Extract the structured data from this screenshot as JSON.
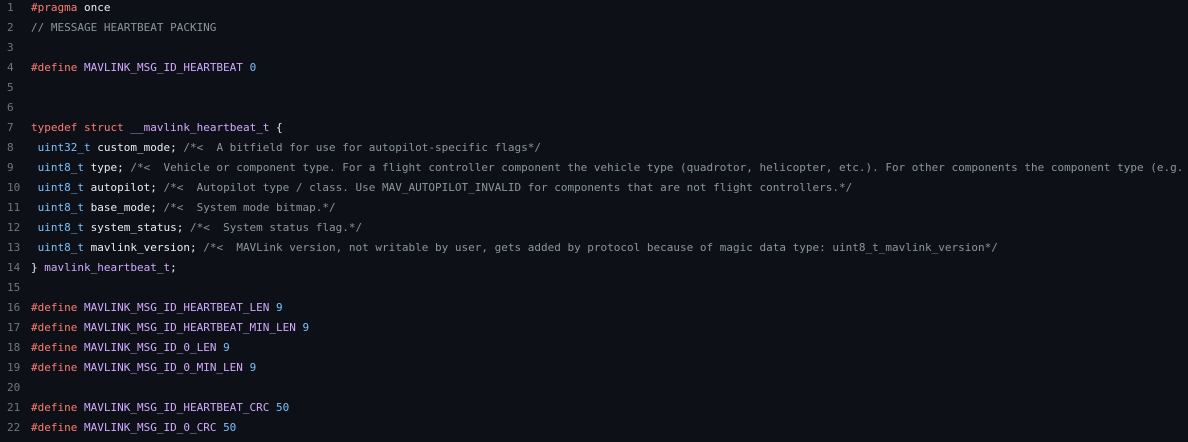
{
  "editor": {
    "lines": [
      {
        "n": "1",
        "tokens": [
          {
            "t": "#",
            "c": "kw"
          },
          {
            "t": "pragma",
            "c": "kw"
          },
          {
            "t": " once",
            "c": "plain"
          }
        ]
      },
      {
        "n": "2",
        "tokens": [
          {
            "t": "// MESSAGE HEARTBEAT PACKING",
            "c": "comment"
          }
        ]
      },
      {
        "n": "3",
        "tokens": []
      },
      {
        "n": "4",
        "tokens": [
          {
            "t": "#define",
            "c": "kw"
          },
          {
            "t": " ",
            "c": "plain"
          },
          {
            "t": "MAVLINK_MSG_ID_HEARTBEAT",
            "c": "def"
          },
          {
            "t": " ",
            "c": "plain"
          },
          {
            "t": "0",
            "c": "num"
          }
        ]
      },
      {
        "n": "5",
        "tokens": []
      },
      {
        "n": "6",
        "tokens": []
      },
      {
        "n": "7",
        "tokens": [
          {
            "t": "typedef",
            "c": "kw"
          },
          {
            "t": " ",
            "c": "plain"
          },
          {
            "t": "struct",
            "c": "kw"
          },
          {
            "t": " ",
            "c": "plain"
          },
          {
            "t": "__mavlink_heartbeat_t",
            "c": "def"
          },
          {
            "t": " {",
            "c": "punct"
          }
        ]
      },
      {
        "n": "8",
        "tokens": [
          {
            "t": " ",
            "c": "plain"
          },
          {
            "t": "uint32_t",
            "c": "type"
          },
          {
            "t": " custom_mode; ",
            "c": "ident"
          },
          {
            "t": "/*<  A bitfield for use for autopilot-specific flags*/",
            "c": "comment"
          }
        ]
      },
      {
        "n": "9",
        "tokens": [
          {
            "t": " ",
            "c": "plain"
          },
          {
            "t": "uint8_t",
            "c": "type"
          },
          {
            "t": " type; ",
            "c": "ident"
          },
          {
            "t": "/*<  Vehicle or component type. For a flight controller component the vehicle type (quadrotor, helicopter, etc.). For other components the component type (e.g.",
            "c": "comment"
          }
        ]
      },
      {
        "n": "10",
        "tokens": [
          {
            "t": " ",
            "c": "plain"
          },
          {
            "t": "uint8_t",
            "c": "type"
          },
          {
            "t": " autopilot; ",
            "c": "ident"
          },
          {
            "t": "/*<  Autopilot type / class. Use MAV_AUTOPILOT_INVALID for components that are not flight controllers.*/",
            "c": "comment"
          }
        ]
      },
      {
        "n": "11",
        "tokens": [
          {
            "t": " ",
            "c": "plain"
          },
          {
            "t": "uint8_t",
            "c": "type"
          },
          {
            "t": " base_mode; ",
            "c": "ident"
          },
          {
            "t": "/*<  System mode bitmap.*/",
            "c": "comment"
          }
        ]
      },
      {
        "n": "12",
        "tokens": [
          {
            "t": " ",
            "c": "plain"
          },
          {
            "t": "uint8_t",
            "c": "type"
          },
          {
            "t": " system_status; ",
            "c": "ident"
          },
          {
            "t": "/*<  System status flag.*/",
            "c": "comment"
          }
        ]
      },
      {
        "n": "13",
        "tokens": [
          {
            "t": " ",
            "c": "plain"
          },
          {
            "t": "uint8_t",
            "c": "type"
          },
          {
            "t": " mavlink_version; ",
            "c": "ident"
          },
          {
            "t": "/*<  MAVLink version, not writable by user, gets added by protocol because of magic data type: uint8_t_mavlink_version*/",
            "c": "comment"
          }
        ]
      },
      {
        "n": "14",
        "tokens": [
          {
            "t": "} ",
            "c": "punct"
          },
          {
            "t": "mavlink_heartbeat_t",
            "c": "def"
          },
          {
            "t": ";",
            "c": "punct"
          }
        ]
      },
      {
        "n": "15",
        "tokens": []
      },
      {
        "n": "16",
        "tokens": [
          {
            "t": "#define",
            "c": "kw"
          },
          {
            "t": " ",
            "c": "plain"
          },
          {
            "t": "MAVLINK_MSG_ID_HEARTBEAT_LEN",
            "c": "def"
          },
          {
            "t": " ",
            "c": "plain"
          },
          {
            "t": "9",
            "c": "num"
          }
        ]
      },
      {
        "n": "17",
        "tokens": [
          {
            "t": "#define",
            "c": "kw"
          },
          {
            "t": " ",
            "c": "plain"
          },
          {
            "t": "MAVLINK_MSG_ID_HEARTBEAT_MIN_LEN",
            "c": "def"
          },
          {
            "t": " ",
            "c": "plain"
          },
          {
            "t": "9",
            "c": "num"
          }
        ]
      },
      {
        "n": "18",
        "tokens": [
          {
            "t": "#define",
            "c": "kw"
          },
          {
            "t": " ",
            "c": "plain"
          },
          {
            "t": "MAVLINK_MSG_ID_0_LEN",
            "c": "def"
          },
          {
            "t": " ",
            "c": "plain"
          },
          {
            "t": "9",
            "c": "num"
          }
        ]
      },
      {
        "n": "19",
        "tokens": [
          {
            "t": "#define",
            "c": "kw"
          },
          {
            "t": " ",
            "c": "plain"
          },
          {
            "t": "MAVLINK_MSG_ID_0_MIN_LEN",
            "c": "def"
          },
          {
            "t": " ",
            "c": "plain"
          },
          {
            "t": "9",
            "c": "num"
          }
        ]
      },
      {
        "n": "20",
        "tokens": []
      },
      {
        "n": "21",
        "tokens": [
          {
            "t": "#define",
            "c": "kw"
          },
          {
            "t": " ",
            "c": "plain"
          },
          {
            "t": "MAVLINK_MSG_ID_HEARTBEAT_CRC",
            "c": "def"
          },
          {
            "t": " ",
            "c": "plain"
          },
          {
            "t": "50",
            "c": "num"
          }
        ]
      },
      {
        "n": "22",
        "tokens": [
          {
            "t": "#define",
            "c": "kw"
          },
          {
            "t": " ",
            "c": "plain"
          },
          {
            "t": "MAVLINK_MSG_ID_0_CRC",
            "c": "def"
          },
          {
            "t": " ",
            "c": "plain"
          },
          {
            "t": "50",
            "c": "num"
          }
        ]
      }
    ]
  },
  "colors": {
    "background": "#0d1117",
    "line_number": "#6e7681",
    "keyword": "#ff7b72",
    "definition": "#d2a8ff",
    "type": "#79c0ff",
    "number": "#79c0ff",
    "comment": "#8b949e",
    "text": "#e6edf3"
  }
}
